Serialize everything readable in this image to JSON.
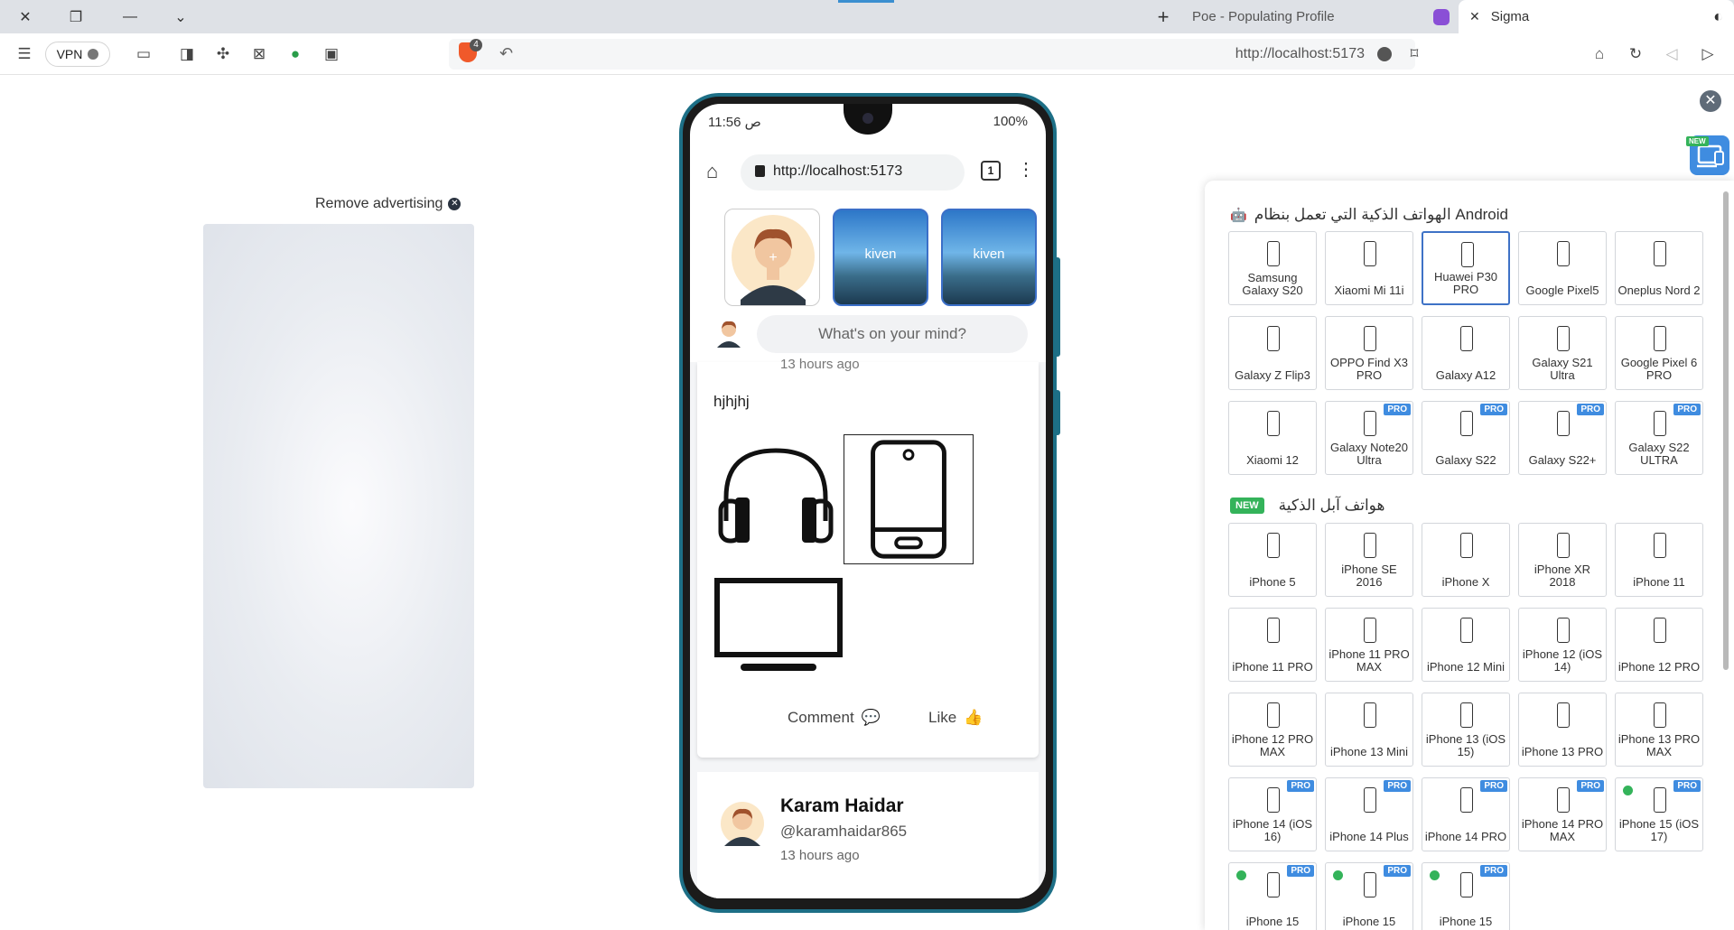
{
  "browser": {
    "tabs": [
      {
        "title": "Poe - Populating Profile"
      },
      {
        "title": "Sigma"
      }
    ],
    "vpn_label": "VPN",
    "brave_count": "4",
    "url": "http://localhost:5173",
    "icons": [
      "close-icon",
      "restore-icon",
      "minimize-icon",
      "chevron-down-icon",
      "new-tab-icon",
      "menu-icon",
      "sidebar-icon",
      "extensions-icon",
      "bookmark-icon",
      "home-icon",
      "reload-icon",
      "back-icon",
      "forward-icon"
    ]
  },
  "ad": {
    "remove_label": "Remove advertising"
  },
  "mobile": {
    "time": "11:56 ص",
    "battery": "100%",
    "url": "http://localhost:5173",
    "tab_count": "1",
    "stories": [
      {
        "label": ""
      },
      {
        "label": "kiven"
      },
      {
        "label": "kiven"
      }
    ],
    "composer_placeholder": "What's on your mind?",
    "post": {
      "time": "13 hours ago",
      "text": "hjhjhj",
      "comment_label": "Comment",
      "like_label": "Like"
    },
    "post2": {
      "name": "Karam Haidar",
      "handle": "@karamhaidar865",
      "time": "13 hours ago"
    }
  },
  "panel": {
    "android_title": "الهواتف الذكية التي تعمل بنظام Android",
    "apple_title": "هواتف آبل الذكية",
    "new_label": "NEW",
    "pro_label": "PRO",
    "android_devices": [
      {
        "name": "Samsung Galaxy S20",
        "pro": false,
        "selected": false
      },
      {
        "name": "Xiaomi Mi 11i",
        "pro": false,
        "selected": false
      },
      {
        "name": "Huawei P30 PRO",
        "pro": false,
        "selected": true
      },
      {
        "name": "Google Pixel5",
        "pro": false,
        "selected": false
      },
      {
        "name": "Oneplus Nord 2",
        "pro": false,
        "selected": false
      },
      {
        "name": "Galaxy Z Flip3",
        "pro": false,
        "selected": false
      },
      {
        "name": "OPPO Find X3 PRO",
        "pro": false,
        "selected": false
      },
      {
        "name": "Galaxy A12",
        "pro": false,
        "selected": false
      },
      {
        "name": "Galaxy S21 Ultra",
        "pro": false,
        "selected": false
      },
      {
        "name": "Google Pixel 6 PRO",
        "pro": false,
        "selected": false
      },
      {
        "name": "Xiaomi 12",
        "pro": false,
        "selected": false
      },
      {
        "name": "Galaxy Note20 Ultra",
        "pro": true,
        "selected": false
      },
      {
        "name": "Galaxy S22",
        "pro": true,
        "selected": false
      },
      {
        "name": "Galaxy S22+",
        "pro": true,
        "selected": false
      },
      {
        "name": "Galaxy S22 ULTRA",
        "pro": true,
        "selected": false
      }
    ],
    "apple_devices": [
      {
        "name": "iPhone 5",
        "pro": false,
        "dot": false
      },
      {
        "name": "iPhone SE 2016",
        "pro": false,
        "dot": false
      },
      {
        "name": "iPhone X",
        "pro": false,
        "dot": false
      },
      {
        "name": "iPhone XR 2018",
        "pro": false,
        "dot": false
      },
      {
        "name": "iPhone 11",
        "pro": false,
        "dot": false
      },
      {
        "name": "iPhone 11 PRO",
        "pro": false,
        "dot": false
      },
      {
        "name": "iPhone 11 PRO MAX",
        "pro": false,
        "dot": false
      },
      {
        "name": "iPhone 12 Mini",
        "pro": false,
        "dot": false
      },
      {
        "name": "iPhone 12 (iOS 14)",
        "pro": false,
        "dot": false
      },
      {
        "name": "iPhone 12 PRO",
        "pro": false,
        "dot": false
      },
      {
        "name": "iPhone 12 PRO MAX",
        "pro": false,
        "dot": false
      },
      {
        "name": "iPhone 13 Mini",
        "pro": false,
        "dot": false
      },
      {
        "name": "iPhone 13 (iOS 15)",
        "pro": false,
        "dot": false
      },
      {
        "name": "iPhone 13 PRO",
        "pro": false,
        "dot": false
      },
      {
        "name": "iPhone 13 PRO MAX",
        "pro": false,
        "dot": false
      },
      {
        "name": "iPhone 14 (iOS 16)",
        "pro": true,
        "dot": false
      },
      {
        "name": "iPhone 14 Plus",
        "pro": true,
        "dot": false
      },
      {
        "name": "iPhone 14 PRO",
        "pro": true,
        "dot": false
      },
      {
        "name": "iPhone 14 PRO MAX",
        "pro": true,
        "dot": false
      },
      {
        "name": "iPhone 15 (iOS 17)",
        "pro": true,
        "dot": true
      },
      {
        "name": "iPhone 15",
        "pro": true,
        "dot": true
      },
      {
        "name": "iPhone 15",
        "pro": true,
        "dot": true
      },
      {
        "name": "iPhone 15",
        "pro": true,
        "dot": true
      }
    ]
  },
  "colors": {
    "accent": "#3f8ce0",
    "new_green": "#34b35a",
    "phone_frame": "#1d6f86"
  }
}
